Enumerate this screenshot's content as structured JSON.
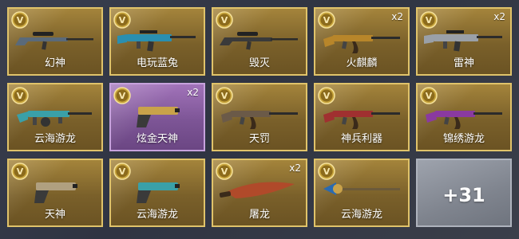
{
  "items": [
    {
      "name": "幻神",
      "count": "",
      "icon": "sniper-rifle-icon",
      "accent": "#5a6a7a",
      "rarity": "gold"
    },
    {
      "name": "电玩蓝兔",
      "count": "",
      "icon": "assault-rifle-icon",
      "accent": "#2a8fb0",
      "rarity": "gold"
    },
    {
      "name": "毁灭",
      "count": "",
      "icon": "sniper-rifle-icon",
      "accent": "#3a3a3a",
      "rarity": "gold"
    },
    {
      "name": "火麒麟",
      "count": "x2",
      "icon": "ak-rifle-icon",
      "accent": "#b8862a",
      "rarity": "gold"
    },
    {
      "name": "雷神",
      "count": "x2",
      "icon": "m4-rifle-icon",
      "accent": "#9aa0a8",
      "rarity": "gold"
    },
    {
      "name": "云海游龙",
      "count": "",
      "icon": "tommy-gun-icon",
      "accent": "#3aa0a8",
      "rarity": "gold"
    },
    {
      "name": "炫金天神",
      "count": "x2",
      "icon": "desert-eagle-icon",
      "accent": "#c9a24a",
      "rarity": "purple"
    },
    {
      "name": "天罚",
      "count": "",
      "icon": "ak-rifle-icon",
      "accent": "#6b5a48",
      "rarity": "gold"
    },
    {
      "name": "神兵利器",
      "count": "",
      "icon": "ak-rifle-icon",
      "accent": "#a03030",
      "rarity": "gold"
    },
    {
      "name": "锦绣游龙",
      "count": "",
      "icon": "ak-rifle-icon",
      "accent": "#8a3aa0",
      "rarity": "gold"
    },
    {
      "name": "天神",
      "count": "",
      "icon": "desert-eagle-icon",
      "accent": "#b0a080",
      "rarity": "gold"
    },
    {
      "name": "云海游龙",
      "count": "",
      "icon": "desert-eagle-icon",
      "accent": "#3aa0a8",
      "rarity": "gold"
    },
    {
      "name": "屠龙",
      "count": "x2",
      "icon": "machete-icon",
      "accent": "#b04a2a",
      "rarity": "gold"
    },
    {
      "name": "云海游龙",
      "count": "",
      "icon": "spear-icon",
      "accent": "#2a6ab0",
      "rarity": "gold"
    }
  ],
  "more": {
    "label": "+31"
  }
}
